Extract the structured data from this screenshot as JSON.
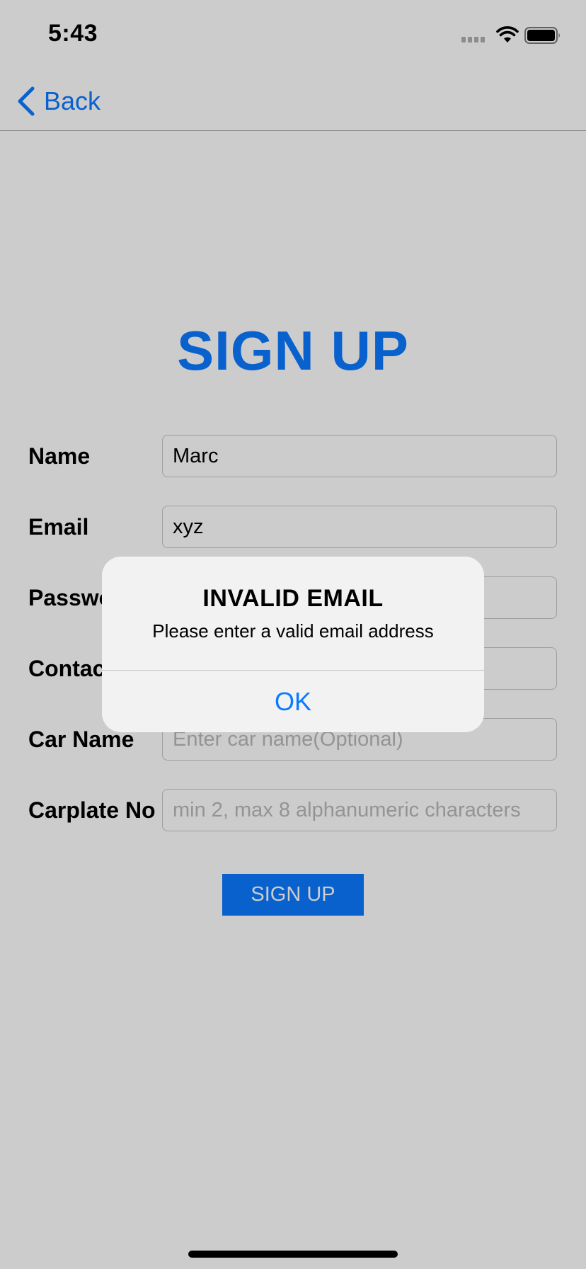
{
  "status_bar": {
    "time": "5:43"
  },
  "nav": {
    "back_label": "Back"
  },
  "page": {
    "title": "SIGN UP"
  },
  "form": {
    "fields": [
      {
        "label": "Name",
        "value": "Marc",
        "placeholder": ""
      },
      {
        "label": "Email",
        "value": "xyz",
        "placeholder": ""
      },
      {
        "label": "Password",
        "value": "",
        "placeholder": ""
      },
      {
        "label": "Contact",
        "value": "",
        "placeholder": ""
      },
      {
        "label": "Car Name",
        "value": "",
        "placeholder": "Enter car name(Optional)"
      },
      {
        "label": "Carplate No",
        "value": "",
        "placeholder": "min 2, max 8 alphanumeric characters"
      }
    ],
    "submit_label": "SIGN UP"
  },
  "alert": {
    "title": "INVALID EMAIL",
    "message": "Please enter a valid email address",
    "ok_label": "OK"
  },
  "colors": {
    "accent": "#0a7aff",
    "background": "#ffffff",
    "overlay": "rgba(0,0,0,0.2)",
    "alert_background": "#f2f2f2"
  },
  "icons": {
    "back": "chevron-left-icon",
    "wifi": "wifi-icon",
    "battery": "battery-icon",
    "signal": "cellular-signal-icon"
  }
}
